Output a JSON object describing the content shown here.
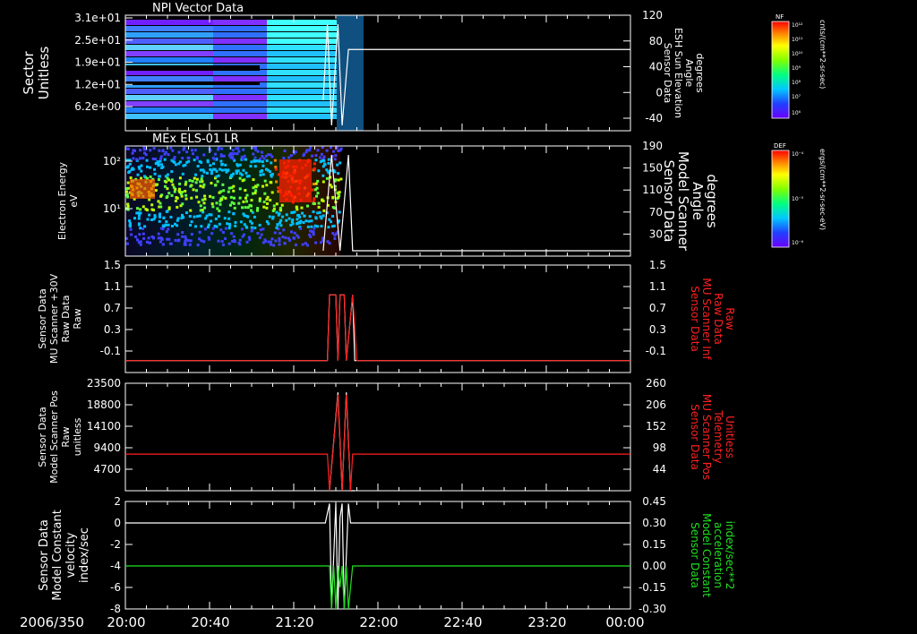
{
  "date_label": "2006/350",
  "time_ticks": [
    "20:00",
    "20:40",
    "21:20",
    "22:00",
    "22:40",
    "23:20",
    "00:00"
  ],
  "colors": {
    "frame": "#ffffff",
    "red": "#ff2020",
    "green": "#20e020",
    "white": "#ffffff"
  },
  "chart_data": [
    {
      "type": "heatmap",
      "title": "NPI Vector Data",
      "left_label": [
        "Sector",
        "Unitless"
      ],
      "left_ticks": [
        "3.1e+01",
        "2.5e+01",
        "1.9e+01",
        "1.2e+01",
        "6.2e+00"
      ],
      "right_label": [
        "Sensor Data",
        "ESH Sun Elevation",
        "Angle",
        "degrees"
      ],
      "right_ticks": [
        "120",
        "80",
        "40",
        "0",
        "-40"
      ],
      "colorbar": {
        "label": "NF",
        "unit": "cnts/(cm**2-sr-sec)",
        "ticks": [
          "10¹²",
          "10¹¹",
          "10¹⁰",
          "10⁹",
          "10⁸",
          "10⁷",
          "10⁶"
        ]
      },
      "overlay_line": {
        "series": "ESH Sun Elevation Angle",
        "time": [
          "20:00",
          "21:34",
          "21:36",
          "21:38",
          "21:41",
          "21:43",
          "21:46",
          "21:48",
          "22:00",
          "00:00"
        ],
        "values": [
          null,
          0,
          120,
          -40,
          120,
          -40,
          80,
          80,
          80,
          80
        ]
      }
    },
    {
      "type": "heatmap",
      "title": "MEx ELS-01 LR",
      "left_label": [
        "Electron Energy",
        "eV"
      ],
      "left_ticks": [
        "10²",
        "10¹"
      ],
      "right_label": [
        "Sensor Data",
        "Model Scanner",
        "Angle",
        "degrees"
      ],
      "right_ticks": [
        "190",
        "150",
        "110",
        "70",
        "30"
      ],
      "colorbar": {
        "label": "DEF",
        "unit": "ergs/(cm**2-sr-sec-eV)",
        "ticks": [
          "10⁻⁴",
          "10⁻⁵",
          "10⁻⁶"
        ]
      },
      "overlay_line": {
        "series": "Model Scanner Angle",
        "time": [
          "21:34",
          "21:38",
          "21:42",
          "21:46",
          "21:48",
          "22:00",
          "00:00"
        ],
        "values": [
          10,
          190,
          10,
          190,
          10,
          10,
          10
        ]
      }
    },
    {
      "type": "line",
      "left_label": [
        "Sensor Data",
        "MU Scanner +30V",
        "Raw Data",
        "Raw"
      ],
      "left_ticks": [
        "1.5",
        "1.1",
        "0.7",
        "0.3",
        "-0.1"
      ],
      "right_label": [
        "Sensor Data",
        "MU Scanner Inf",
        "Raw Data",
        "Raw"
      ],
      "right_ticks": [
        "1.5",
        "1.1",
        "0.7",
        "0.3",
        "-0.1"
      ],
      "ylim": [
        -0.3,
        1.5
      ],
      "series": [
        {
          "color": "white",
          "time": [
            "20:00",
            "21:36",
            "21:37",
            "21:40",
            "21:41",
            "21:42",
            "21:44",
            "21:45",
            "21:48",
            "21:49",
            "00:00"
          ],
          "values": [
            -0.1,
            -0.1,
            1.0,
            1.0,
            -0.1,
            1.0,
            1.0,
            -0.1,
            1.0,
            -0.1,
            -0.1
          ]
        },
        {
          "color": "red",
          "time": [
            "20:00",
            "21:36",
            "21:37",
            "21:40",
            "21:41",
            "21:42",
            "21:44",
            "21:45",
            "21:48",
            "21:50",
            "00:00"
          ],
          "values": [
            -0.1,
            -0.1,
            1.0,
            1.0,
            -0.1,
            1.0,
            1.0,
            -0.1,
            1.0,
            -0.1,
            -0.1
          ]
        }
      ]
    },
    {
      "type": "line",
      "left_label": [
        "Sensor Data",
        "Model Scanner Pos",
        "Raw",
        "unitless"
      ],
      "left_ticks": [
        "23500",
        "18800",
        "14100",
        "9400",
        "4700"
      ],
      "right_label": [
        "Sensor Data",
        "MU Scanner Pos",
        "Telemetry",
        "Unitless"
      ],
      "right_ticks": [
        "260",
        "206",
        "152",
        "98",
        "44"
      ],
      "ylim": [
        0,
        23500
      ],
      "series": [
        {
          "color": "white",
          "time": [
            "21:37",
            "21:41",
            "21:43",
            "21:45",
            "21:47",
            "21:49"
          ],
          "values": [
            0,
            21500,
            0,
            21500,
            0,
            0
          ]
        },
        {
          "color": "red",
          "time": [
            "20:00",
            "21:36",
            "21:37",
            "21:41",
            "21:43",
            "21:45",
            "21:47",
            "21:48",
            "00:00"
          ],
          "values": [
            8000,
            8000,
            0,
            21000,
            0,
            21000,
            0,
            8000,
            8000
          ]
        }
      ]
    },
    {
      "type": "line",
      "left_label": [
        "Sensor Data",
        "Model Constant",
        "velocity",
        "index/sec"
      ],
      "left_ticks": [
        "2",
        "0",
        "-2",
        "-4",
        "-6",
        "-8"
      ],
      "right_label": [
        "Sensor Data",
        "Model Constant",
        "acceleration",
        "index/sec**2"
      ],
      "right_ticks": [
        "0.45",
        "0.30",
        "0.15",
        "0.00",
        "-0.15",
        "-0.30"
      ],
      "ylim": [
        -8,
        2
      ],
      "series": [
        {
          "color": "white",
          "time": [
            "20:00",
            "21:35",
            "21:37",
            "21:38",
            "21:40",
            "21:41",
            "21:42",
            "21:43",
            "21:44",
            "21:46",
            "21:47",
            "00:00"
          ],
          "values": [
            0,
            0,
            1.8,
            -8,
            1.8,
            -8,
            0.5,
            1.8,
            -8,
            1.8,
            0,
            0
          ]
        },
        {
          "color": "green",
          "time": [
            "20:00",
            "21:37",
            "21:38",
            "21:39",
            "21:40",
            "21:41",
            "21:42",
            "21:43",
            "21:44",
            "21:45",
            "21:46",
            "21:48",
            "00:00"
          ],
          "values": [
            -4,
            -4,
            -8,
            -4,
            -8,
            -4,
            -6,
            -4,
            -8,
            -4,
            -8,
            -4,
            -4
          ]
        }
      ]
    }
  ]
}
